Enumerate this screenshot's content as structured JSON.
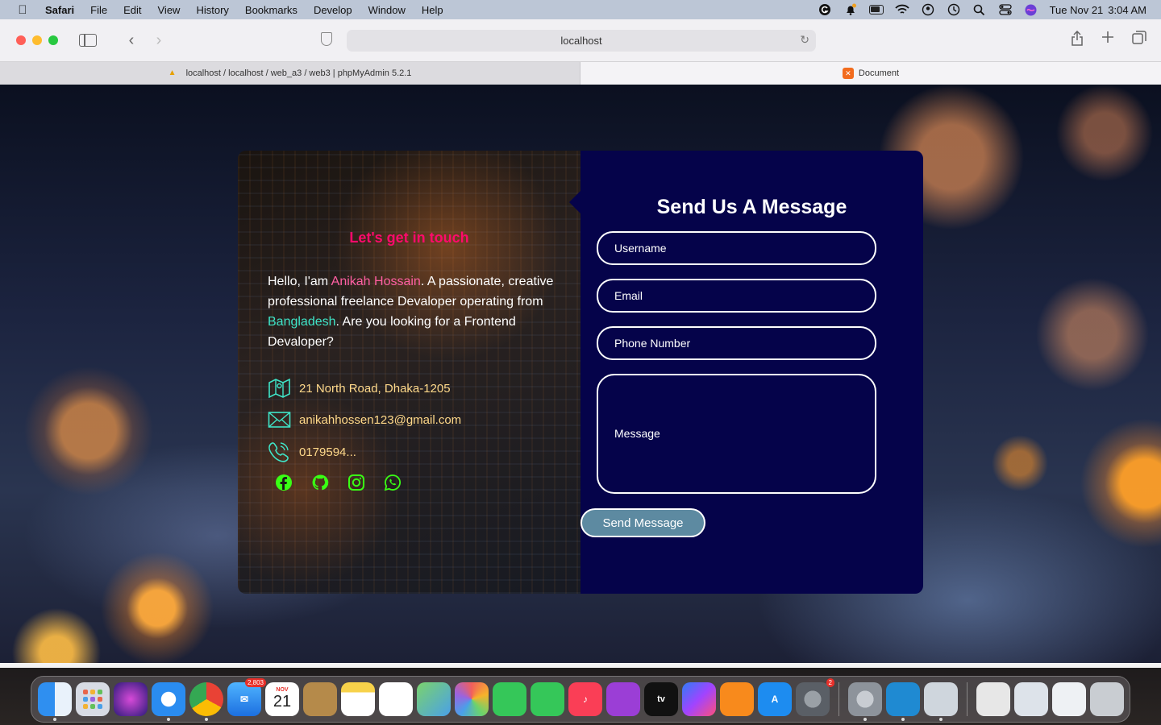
{
  "menubar": {
    "app_name": "Safari",
    "menus": [
      "File",
      "Edit",
      "View",
      "History",
      "Bookmarks",
      "Develop",
      "Window",
      "Help"
    ],
    "date": "Tue Nov 21",
    "time": "3:04 AM"
  },
  "browser": {
    "url": "localhost",
    "tabs": [
      {
        "label": "localhost / localhost / web_a3 / web3 | phpMyAdmin 5.2.1",
        "active": false
      },
      {
        "label": "Document",
        "active": true
      }
    ]
  },
  "contact": {
    "heading": "Let's get in touch",
    "intro_pre": "Hello, I'am ",
    "intro_name": "Anikah Hossain",
    "intro_mid": ". A passionate, creative professional freelance Devaloper operating from ",
    "intro_country": "Bangladesh",
    "intro_post": ". Are you looking for a Frontend Devaloper?",
    "address": "21 North Road, Dhaka-1205",
    "email": "anikahhossen123@gmail.com",
    "phone": "0179594...",
    "social_icons": [
      "facebook-icon",
      "github-icon",
      "instagram-icon",
      "whatsapp-icon"
    ]
  },
  "form": {
    "title": "Send Us A Message",
    "username_placeholder": "Username",
    "email_placeholder": "Email",
    "phone_placeholder": "Phone Number",
    "message_placeholder": "Message",
    "submit_label": "Send Message"
  },
  "colors": {
    "accent_pink": "#ff0a6c",
    "accent_teal": "#3fe5c8",
    "form_bg": "#05034a",
    "button_bg": "#5d8aa1",
    "icon_green": "#39ff14"
  },
  "dock": {
    "mail_badge": "2,803",
    "calendar_month": "NOV",
    "calendar_day": "21",
    "settings_badge": "2"
  }
}
